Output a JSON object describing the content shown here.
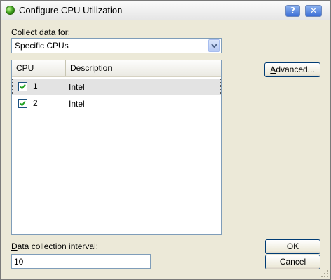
{
  "window": {
    "title": "Configure CPU Utilization",
    "help_button": "?",
    "close_button": "✕"
  },
  "collect": {
    "label_accel": "C",
    "label_rest": "ollect data for:",
    "selected": "Specific CPUs"
  },
  "cpu_list": {
    "columns": [
      "CPU",
      "Description"
    ],
    "rows": [
      {
        "cpu": "1",
        "description": "Intel",
        "checked": true,
        "selected": true
      },
      {
        "cpu": "2",
        "description": "Intel",
        "checked": true,
        "selected": false
      }
    ]
  },
  "buttons": {
    "advanced_accel": "A",
    "advanced_rest": "dvanced...",
    "ok": "OK",
    "cancel": "Cancel"
  },
  "interval": {
    "label_accel": "D",
    "label_rest": "ata collection interval:",
    "value": "10"
  }
}
